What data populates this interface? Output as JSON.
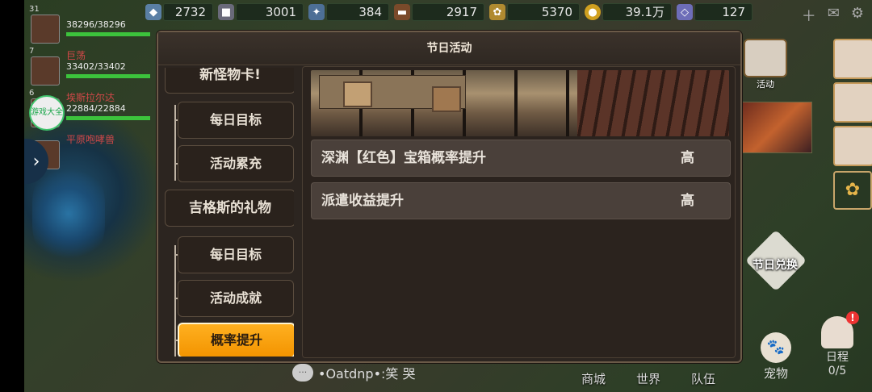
{
  "resources": [
    {
      "icon": "crystal-icon",
      "value": "2732"
    },
    {
      "icon": "ore-icon",
      "value": "3001"
    },
    {
      "icon": "gem-cluster-icon",
      "value": "384"
    },
    {
      "icon": "wood-icon",
      "value": "2917"
    },
    {
      "icon": "wheat-icon",
      "value": "5370"
    },
    {
      "icon": "coin-icon",
      "value": "39.1万"
    },
    {
      "icon": "diamond-icon",
      "value": "127"
    }
  ],
  "party": [
    {
      "level": "31",
      "hp": "38296/38296"
    },
    {
      "level": "7",
      "name": "巨荡",
      "hp": "33402/33402"
    },
    {
      "level": "6",
      "name": "埃斯拉尔达",
      "hp": "22884/22884"
    },
    {
      "level": "",
      "name": "平原咆哮兽",
      "hp": ""
    }
  ],
  "badge_game": "游戏大全",
  "activity_label": "活动",
  "festival_exchange": "节日兑换",
  "bottom_nav": [
    "商城",
    "世界",
    "队伍"
  ],
  "pet_label": "宠物",
  "schedule": {
    "label": "日程",
    "count": "0/5"
  },
  "chat_text": "•Oatdnp•:笑 哭",
  "modal": {
    "title": "节日活动",
    "nav": {
      "group1": "新怪物卡!",
      "group1_items": [
        "每日目标",
        "活动累充"
      ],
      "group2": "吉格斯的礼物",
      "group2_items": [
        "每日目标",
        "活动成就",
        "概率提升"
      ]
    },
    "rows": [
      {
        "name": "深渊【红色】宝箱概率提升",
        "level": "高"
      },
      {
        "name": "派遣收益提升",
        "level": "高"
      }
    ]
  }
}
